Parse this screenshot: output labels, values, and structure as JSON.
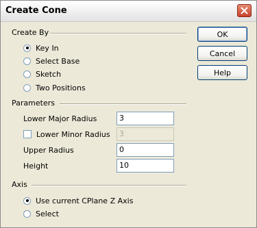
{
  "window": {
    "title": "Create Cone"
  },
  "groups": {
    "create_by": "Create By",
    "parameters": "Parameters",
    "axis": "Axis"
  },
  "create_by_options": [
    {
      "label": "Key In",
      "selected": true
    },
    {
      "label": "Select Base",
      "selected": false
    },
    {
      "label": "Sketch",
      "selected": false
    },
    {
      "label": "Two Positions",
      "selected": false
    }
  ],
  "parameters": {
    "lower_major_radius": {
      "label": "Lower Major Radius",
      "value": "3"
    },
    "lower_minor_radius": {
      "label": "Lower Minor Radius",
      "value": "3",
      "checked": false,
      "enabled": false
    },
    "upper_radius": {
      "label": "Upper Radius",
      "value": "0"
    },
    "height": {
      "label": "Height",
      "value": "10"
    }
  },
  "axis_options": [
    {
      "label": "Use current CPlane Z Axis",
      "selected": true
    },
    {
      "label": "Select",
      "selected": false
    }
  ],
  "buttons": {
    "ok": "OK",
    "cancel": "Cancel",
    "help": "Help"
  }
}
